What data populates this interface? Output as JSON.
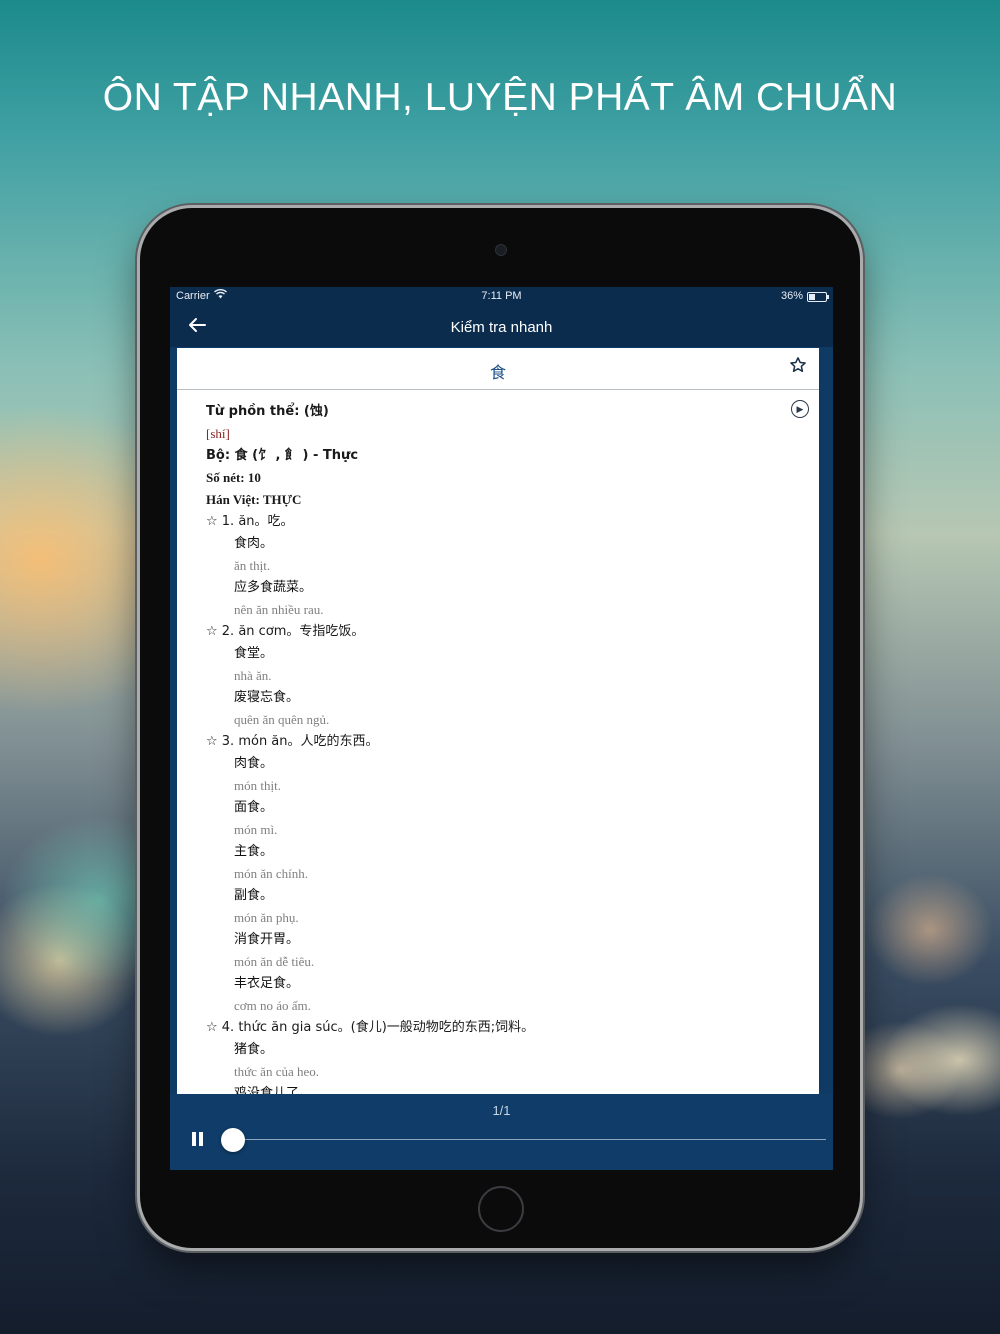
{
  "headline": "ÔN TẬP NHANH, LUYỆN PHÁT ÂM CHUẨN",
  "status_bar": {
    "carrier": "Carrier",
    "time": "7:11 PM",
    "battery": "36%"
  },
  "nav": {
    "title": "Kiểm tra nhanh"
  },
  "card": {
    "word": "食",
    "traditional": "Từ phồn thể: (蚀)",
    "pinyin": "[shí]",
    "radical": "Bộ: 食 (饣 , 飠 ) - Thực",
    "strokes": "Số nét: 10",
    "han_viet": "Hán Việt: THỰC",
    "senses": [
      {
        "label": "☆ 1. ăn。吃。",
        "examples": [
          {
            "zh": "食肉。",
            "vi": "ăn thịt."
          },
          {
            "zh": "应多食蔬菜。",
            "vi": "nên ăn nhiều rau."
          }
        ]
      },
      {
        "label": "☆ 2. ăn cơm。专指吃饭。",
        "examples": [
          {
            "zh": "食堂。",
            "vi": "nhà ăn."
          },
          {
            "zh": "废寝忘食。",
            "vi": "quên ăn quên ngủ."
          }
        ]
      },
      {
        "label": "☆ 3. món ăn。人吃的东西。",
        "examples": [
          {
            "zh": "肉食。",
            "vi": "món thịt."
          },
          {
            "zh": "面食。",
            "vi": "món mì."
          },
          {
            "zh": "主食。",
            "vi": "món ăn chính."
          },
          {
            "zh": "副食。",
            "vi": "món ăn phụ."
          },
          {
            "zh": "消食开胃。",
            "vi": "món ăn dễ tiêu."
          },
          {
            "zh": "丰衣足食。",
            "vi": "cơm no áo ấm."
          }
        ]
      },
      {
        "label": "☆ 4. thức ăn gia súc。(食儿)一般动物吃的东西;饲料。",
        "examples": [
          {
            "zh": "猪食。",
            "vi": "thức ăn của heo."
          },
          {
            "zh": "鸡没食儿了。",
            "vi": ""
          }
        ]
      }
    ]
  },
  "player": {
    "pager": "1/1",
    "progress": 0.0
  }
}
